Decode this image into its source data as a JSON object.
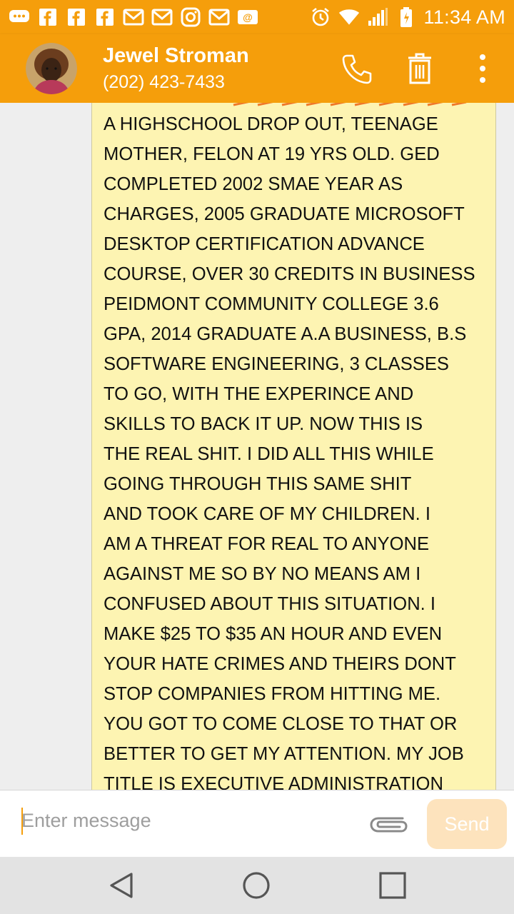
{
  "status_bar": {
    "time": "11:34 AM",
    "notification_icons": [
      "chat-icon",
      "facebook-icon",
      "facebook-icon",
      "facebook-icon",
      "gmail-icon",
      "gmail-icon",
      "instagram-icon",
      "gmail-icon",
      "email-icon"
    ],
    "system_icons": [
      "alarm-icon",
      "wifi-icon",
      "signal-icon",
      "battery-icon"
    ]
  },
  "header": {
    "contact_name": "Jewel Stroman",
    "contact_phone": "(202) 423-7433"
  },
  "message": {
    "text": "A HIGHSCHOOL DROP OUT, TEENAGE\nMOTHER, FELON AT 19 YRS OLD. GED\nCOMPLETED 2002 SMAE YEAR AS\nCHARGES, 2005 GRADUATE MICROSOFT\nDESKTOP CERTIFICATION ADVANCE\nCOURSE, OVER 30 CREDITS IN BUSINESS\nPEIDMONT COMMUNITY COLLEGE 3.6\nGPA, 2014 GRADUATE A.A BUSINESS, B.S\nSOFTWARE ENGINEERING, 3 CLASSES\nTO GO, WITH THE EXPERINCE AND\nSKILLS TO BACK IT UP. NOW THIS IS\nTHE REAL SHIT. I DID ALL THIS WHILE\nGOING THROUGH THIS SAME SHIT\nAND TOOK CARE OF MY CHILDREN. I\nAM A THREAT FOR REAL TO ANYONE\nAGAINST ME SO BY NO MEANS AM I\nCONFUSED ABOUT THIS SITUATION. I\nMAKE $25 TO $35 AN HOUR AND EVEN\nYOUR HATE CRIMES AND THEIRS DONT\nSTOP COMPANIES FROM HITTING ME.\nYOU GOT TO COME CLOSE TO THAT OR\nBETTER TO GET MY ATTENTION. MY JOB\nTITLE IS EXECUTIVE ADMINISTRATION"
  },
  "compose": {
    "placeholder": "Enter message",
    "send_label": "Send"
  },
  "colors": {
    "accent": "#f59e0b",
    "bubble": "#fdf4b2",
    "send_disabled": "#fde3bd"
  }
}
